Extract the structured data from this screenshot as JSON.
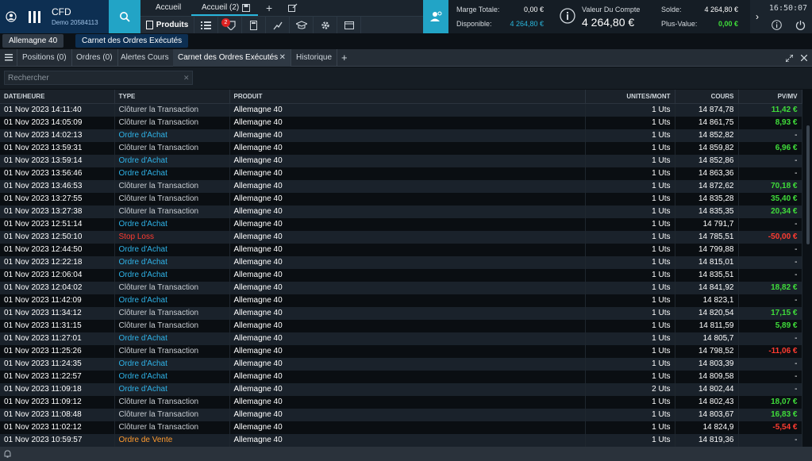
{
  "app": {
    "name": "CFD",
    "account_id": "Demo 20584113"
  },
  "top_tabs": {
    "home": "Accueil",
    "home_count": "Accueil (2)",
    "add_symbol": "+"
  },
  "toolbar": {
    "produits": "Produits",
    "badge_count": "2"
  },
  "account": {
    "marge_totale_label": "Marge Totale:",
    "marge_totale_value": "0,00 €",
    "disponible_label": "Disponible:",
    "disponible_value": "4 264,80 €",
    "valeur_label": "Valeur Du Compte",
    "valeur_value": "4 264,80 €",
    "solde_label": "Solde:",
    "solde_value": "4 264,80 €",
    "plus_value_label": "Plus-Value:",
    "plus_value_value": "0,00 €",
    "clock": "16:50:07",
    "chevron": "›"
  },
  "sub_tabs": {
    "allemagne": "Allemagne 40",
    "carnet": "Carnet des Ordres Exécutés"
  },
  "panel_tabs": {
    "positions": "Positions (0)",
    "ordres": "Ordres (0)",
    "alertes": "Alertes Cours",
    "carnet": "Carnet des Ordres Exécutés",
    "historique": "Historique",
    "add": "+"
  },
  "search": {
    "placeholder": "Rechercher"
  },
  "table": {
    "headers": [
      "DATE/HEURE",
      "TYPE",
      "PRODUIT",
      "UNITES/MONT",
      "COURS",
      "PV/MV"
    ],
    "rows": [
      [
        "01 Nov 2023 14:11:40",
        "Clôturer la Transaction",
        "Allemagne 40",
        "1 Uts",
        "14 874,78",
        "11,42 €",
        "close",
        "pos"
      ],
      [
        "01 Nov 2023 14:05:09",
        "Clôturer la Transaction",
        "Allemagne 40",
        "1 Uts",
        "14 861,75",
        "8,93 €",
        "close",
        "pos"
      ],
      [
        "01 Nov 2023 14:02:13",
        "Ordre d'Achat",
        "Allemagne 40",
        "1 Uts",
        "14 852,82",
        "-",
        "buy",
        "none"
      ],
      [
        "01 Nov 2023 13:59:31",
        "Clôturer la Transaction",
        "Allemagne 40",
        "1 Uts",
        "14 859,82",
        "6,96 €",
        "close",
        "pos"
      ],
      [
        "01 Nov 2023 13:59:14",
        "Ordre d'Achat",
        "Allemagne 40",
        "1 Uts",
        "14 852,86",
        "-",
        "buy",
        "none"
      ],
      [
        "01 Nov 2023 13:56:46",
        "Ordre d'Achat",
        "Allemagne 40",
        "1 Uts",
        "14 863,36",
        "-",
        "buy",
        "none"
      ],
      [
        "01 Nov 2023 13:46:53",
        "Clôturer la Transaction",
        "Allemagne 40",
        "1 Uts",
        "14 872,62",
        "70,18 €",
        "close",
        "pos"
      ],
      [
        "01 Nov 2023 13:27:55",
        "Clôturer la Transaction",
        "Allemagne 40",
        "1 Uts",
        "14 835,28",
        "35,40 €",
        "close",
        "pos"
      ],
      [
        "01 Nov 2023 13:27:38",
        "Clôturer la Transaction",
        "Allemagne 40",
        "1 Uts",
        "14 835,35",
        "20,34 €",
        "close",
        "pos"
      ],
      [
        "01 Nov 2023 12:51:14",
        "Ordre d'Achat",
        "Allemagne 40",
        "1 Uts",
        "14 791,7",
        "-",
        "buy",
        "none"
      ],
      [
        "01 Nov 2023 12:50:10",
        "Stop Loss",
        "Allemagne 40",
        "1 Uts",
        "14 785,51",
        "-50,00 €",
        "stop",
        "neg"
      ],
      [
        "01 Nov 2023 12:44:50",
        "Ordre d'Achat",
        "Allemagne 40",
        "1 Uts",
        "14 799,88",
        "-",
        "buy",
        "none"
      ],
      [
        "01 Nov 2023 12:22:18",
        "Ordre d'Achat",
        "Allemagne 40",
        "1 Uts",
        "14 815,01",
        "-",
        "buy",
        "none"
      ],
      [
        "01 Nov 2023 12:06:04",
        "Ordre d'Achat",
        "Allemagne 40",
        "1 Uts",
        "14 835,51",
        "-",
        "buy",
        "none"
      ],
      [
        "01 Nov 2023 12:04:02",
        "Clôturer la Transaction",
        "Allemagne 40",
        "1 Uts",
        "14 841,92",
        "18,82 €",
        "close",
        "pos"
      ],
      [
        "01 Nov 2023 11:42:09",
        "Ordre d'Achat",
        "Allemagne 40",
        "1 Uts",
        "14 823,1",
        "-",
        "buy",
        "none"
      ],
      [
        "01 Nov 2023 11:34:12",
        "Clôturer la Transaction",
        "Allemagne 40",
        "1 Uts",
        "14 820,54",
        "17,15 €",
        "close",
        "pos"
      ],
      [
        "01 Nov 2023 11:31:15",
        "Clôturer la Transaction",
        "Allemagne 40",
        "1 Uts",
        "14 811,59",
        "5,89 €",
        "close",
        "pos"
      ],
      [
        "01 Nov 2023 11:27:01",
        "Ordre d'Achat",
        "Allemagne 40",
        "1 Uts",
        "14 805,7",
        "-",
        "buy",
        "none"
      ],
      [
        "01 Nov 2023 11:25:26",
        "Clôturer la Transaction",
        "Allemagne 40",
        "1 Uts",
        "14 798,52",
        "-11,06 €",
        "close",
        "neg"
      ],
      [
        "01 Nov 2023 11:24:35",
        "Ordre d'Achat",
        "Allemagne 40",
        "1 Uts",
        "14 803,39",
        "-",
        "buy",
        "none"
      ],
      [
        "01 Nov 2023 11:22:57",
        "Ordre d'Achat",
        "Allemagne 40",
        "1 Uts",
        "14 809,58",
        "-",
        "buy",
        "none"
      ],
      [
        "01 Nov 2023 11:09:18",
        "Ordre d'Achat",
        "Allemagne 40",
        "2 Uts",
        "14 802,44",
        "-",
        "buy",
        "none"
      ],
      [
        "01 Nov 2023 11:09:12",
        "Clôturer la Transaction",
        "Allemagne 40",
        "1 Uts",
        "14 802,43",
        "18,07 €",
        "close",
        "pos"
      ],
      [
        "01 Nov 2023 11:08:48",
        "Clôturer la Transaction",
        "Allemagne 40",
        "1 Uts",
        "14 803,67",
        "16,83 €",
        "close",
        "pos"
      ],
      [
        "01 Nov 2023 11:02:12",
        "Clôturer la Transaction",
        "Allemagne 40",
        "1 Uts",
        "14 824,9",
        "-5,54 €",
        "close",
        "neg"
      ],
      [
        "01 Nov 2023 10:59:57",
        "Ordre de Vente",
        "Allemagne 40",
        "1 Uts",
        "14 819,36",
        "-",
        "sell",
        "none"
      ]
    ]
  },
  "colors": {
    "close": "#c8cdd2",
    "buy": "#2fb3e8",
    "stop": "#ff3b30",
    "sell": "#ff9a2e",
    "pos": "#3fdc3a",
    "neg": "#ff3b30",
    "none": "#ffffff",
    "accent": "#22a4c6",
    "navy": "#0d2f52"
  }
}
